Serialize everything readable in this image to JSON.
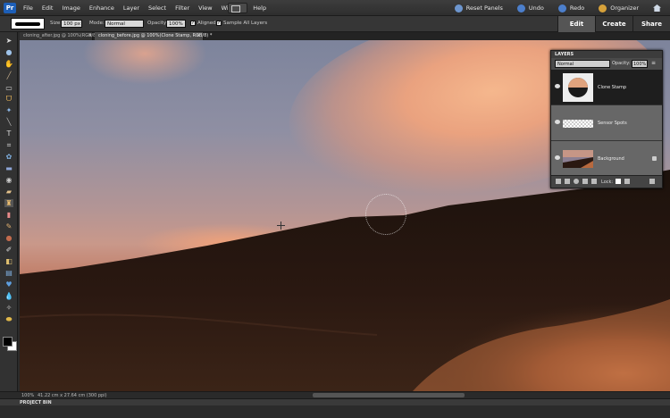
{
  "app": {
    "logo_text": "Pr"
  },
  "menu": [
    "File",
    "Edit",
    "Image",
    "Enhance",
    "Layer",
    "Select",
    "Filter",
    "View",
    "Window",
    "Help"
  ],
  "topright": {
    "reset_panels": "Reset Panels",
    "undo": "Undo",
    "redo": "Redo",
    "organizer": "Organizer"
  },
  "mode_tabs": {
    "edit": "Edit",
    "create": "Create",
    "share": "Share",
    "active": "edit"
  },
  "options": {
    "size_label": "Size:",
    "size_value": "100 px",
    "mode_label": "Mode:",
    "mode_value": "Normal",
    "opacity_label": "Opacity:",
    "opacity_value": "100%",
    "aligned_label": "Aligned",
    "aligned_checked": true,
    "sample_label": "Sample All Layers",
    "sample_checked": true
  },
  "documents": [
    {
      "label": "cloning_after.jpg @ 100%(RGB/8)",
      "active": false
    },
    {
      "label": "cloning_before.jpg @ 100%(Clone Stamp, RGB/8) *",
      "active": true
    }
  ],
  "layers_panel": {
    "title": "LAYERS",
    "blend_mode": "Normal",
    "opacity_label": "Opacity:",
    "opacity_value": "100%",
    "layers": [
      {
        "name": "Clone Stamp",
        "selected": true,
        "locked": false
      },
      {
        "name": "Sensor Spots",
        "selected": false,
        "locked": false
      },
      {
        "name": "Background",
        "selected": false,
        "locked": true
      }
    ],
    "lock_label": "Lock:"
  },
  "status": {
    "zoom": "100%",
    "dimensions": "41.22 cm x 27.64 cm (300 ppi)"
  },
  "project_bin": "PROJECT BIN",
  "colors": {
    "accent": "#1d5fb8",
    "selected_layer": "#1e1e1e"
  }
}
